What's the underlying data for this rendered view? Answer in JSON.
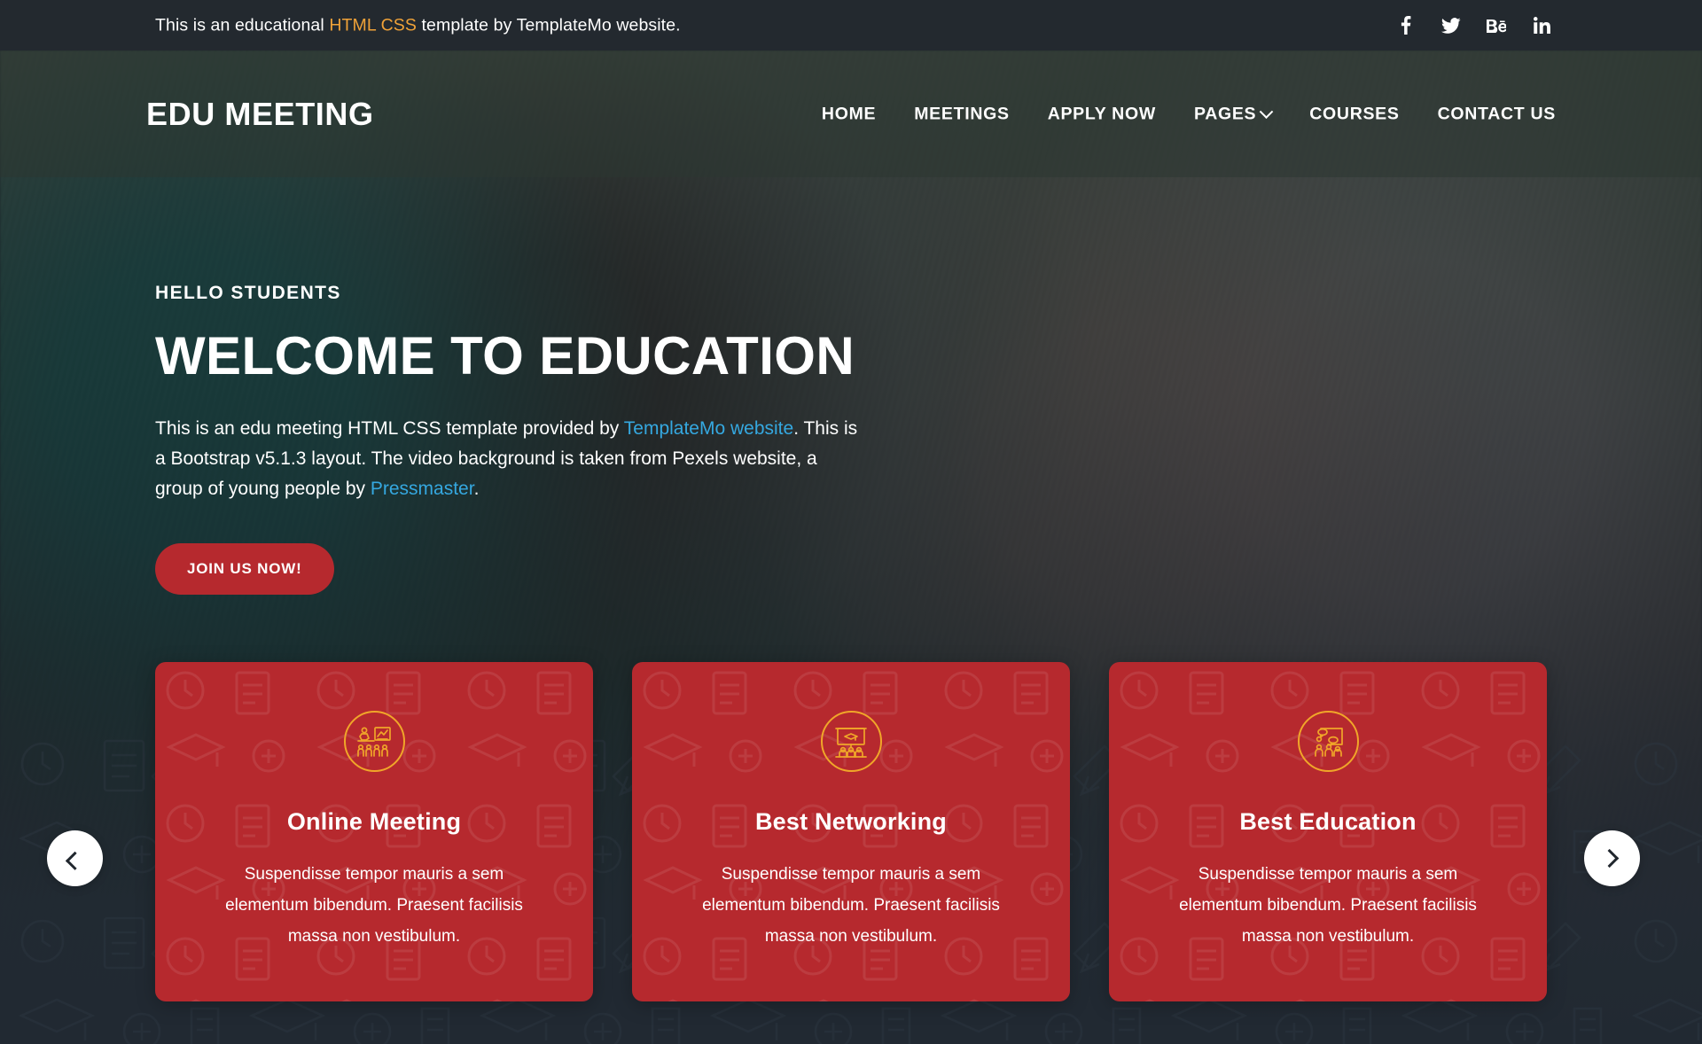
{
  "topbar": {
    "text_before": "This is an educational ",
    "accent_text": "HTML CSS",
    "text_after": " template by TemplateMo website.",
    "accent_color": "#f0a238",
    "social": [
      {
        "name": "facebook-icon",
        "label": "Facebook"
      },
      {
        "name": "twitter-icon",
        "label": "Twitter"
      },
      {
        "name": "behance-icon",
        "label": "Behance"
      },
      {
        "name": "linkedin-icon",
        "label": "LinkedIn"
      }
    ]
  },
  "header": {
    "logo": "EDU MEETING",
    "nav": [
      {
        "label": "HOME",
        "has_dropdown": false
      },
      {
        "label": "MEETINGS",
        "has_dropdown": false
      },
      {
        "label": "APPLY NOW",
        "has_dropdown": false
      },
      {
        "label": "PAGES",
        "has_dropdown": true
      },
      {
        "label": "COURSES",
        "has_dropdown": false
      },
      {
        "label": "CONTACT US",
        "has_dropdown": false
      }
    ]
  },
  "hero": {
    "kicker": "HELLO STUDENTS",
    "title": "WELCOME TO EDUCATION",
    "paragraph": {
      "part1": "This is an edu meeting HTML CSS template provided by ",
      "link1": "TemplateMo website",
      "part2": ". This is a Bootstrap v5.1.3 layout. The video background is taken from Pexels website, a group of young people by ",
      "link2": "Pressmaster",
      "part3": "."
    },
    "link_color": "#35a8e0",
    "cta_label": "JOIN US NOW!",
    "cta_color": "#b6292e"
  },
  "cards": {
    "accent_color": "#b6292e",
    "icon_color": "#f0a629",
    "items": [
      {
        "icon": "presentation-chart-audience-icon",
        "title": "Online Meeting",
        "text": "Suspendisse tempor mauris a sem elementum bibendum. Praesent facilisis massa non vestibulum."
      },
      {
        "icon": "whiteboard-graduation-audience-icon",
        "title": "Best Networking",
        "text": "Suspendisse tempor mauris a sem elementum bibendum. Praesent facilisis massa non vestibulum."
      },
      {
        "icon": "discussion-board-people-icon",
        "title": "Best Education",
        "text": "Suspendisse tempor mauris a sem elementum bibendum. Praesent facilisis massa non vestibulum."
      }
    ]
  },
  "carousel": {
    "prev_label": "Previous",
    "next_label": "Next"
  }
}
